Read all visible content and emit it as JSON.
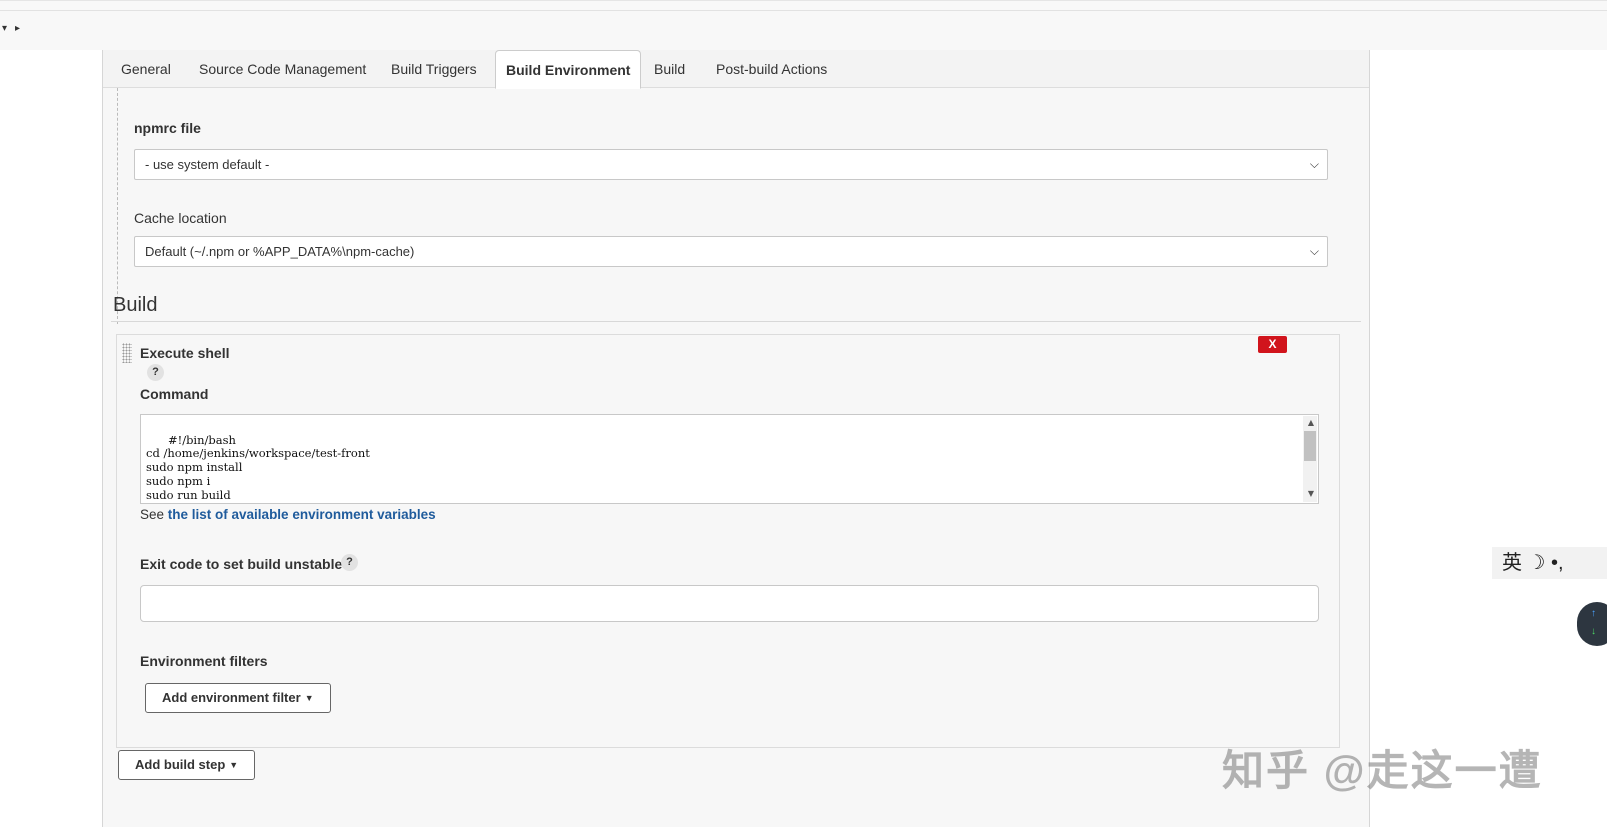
{
  "tabs": [
    {
      "label": "General"
    },
    {
      "label": "Source Code Management"
    },
    {
      "label": "Build Triggers"
    },
    {
      "label": "Build Environment"
    },
    {
      "label": "Build"
    },
    {
      "label": "Post-build Actions"
    }
  ],
  "env": {
    "npmrc_label": "npmrc file",
    "npmrc_value": "- use system default -",
    "cache_label": "Cache location",
    "cache_value": "Default (~/.npm or %APP_DATA%\\npm-cache)"
  },
  "build": {
    "section_title": "Build",
    "step_title": "Execute shell",
    "delete_label": "X",
    "help_glyph": "?",
    "command_label": "Command",
    "command_text": "#!/bin/bash\ncd /home/jenkins/workspace/test-front\nsudo npm install\nsudo npm i\nsudo run build\ncd dist",
    "see_prefix": "See ",
    "see_link": "the list of available environment variables",
    "exit_code_label": "Exit code to set build unstable",
    "exit_code_value": "",
    "env_filters_label": "Environment filters",
    "add_env_filter_label": "Add environment filter",
    "add_build_step_label": "Add build step"
  },
  "overlay": {
    "ime_text": "英 ☽ •,",
    "watermark": "知乎 @走这一遭"
  }
}
